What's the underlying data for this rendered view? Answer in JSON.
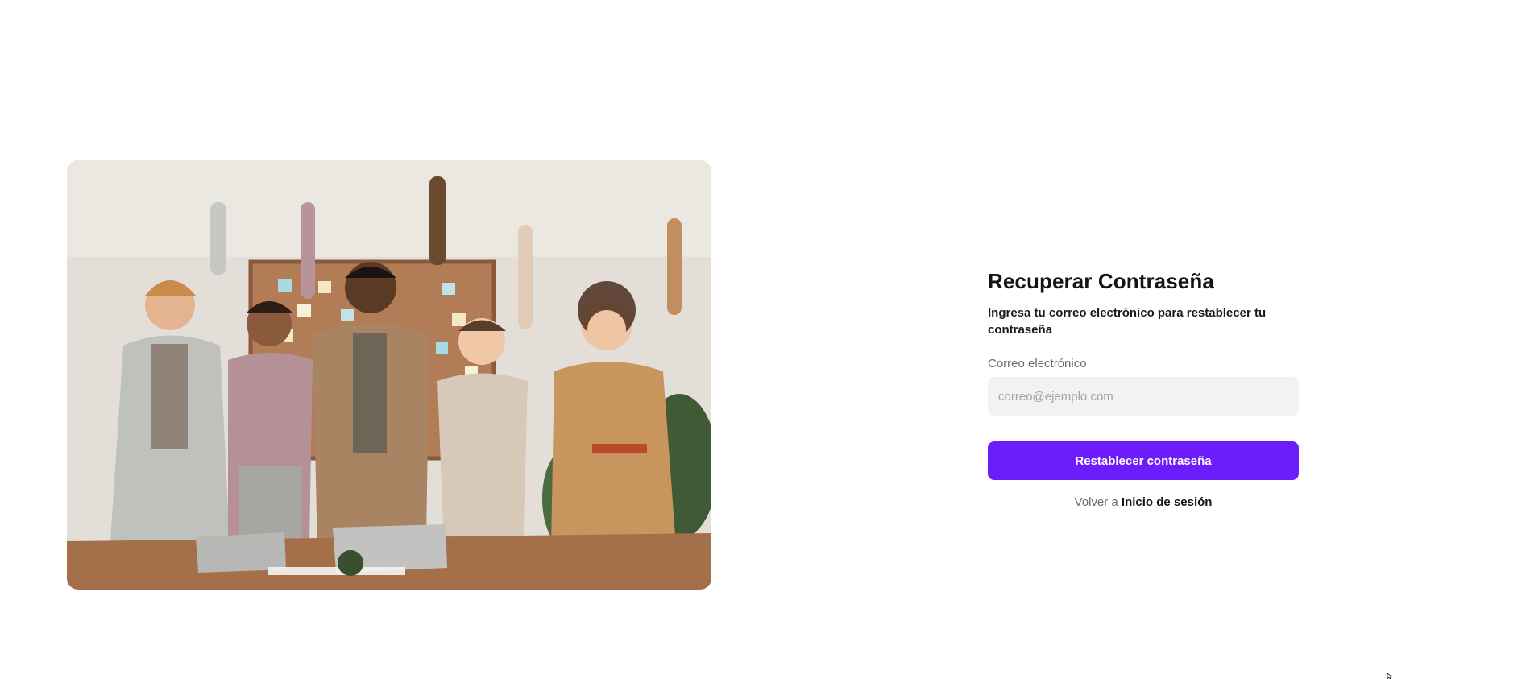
{
  "hero_image": {
    "icon": "team-celebration-photo",
    "colors": {
      "wall": "#e7e3dc",
      "corkboard": "#b27d56",
      "table": "#a4704a"
    }
  },
  "form": {
    "title": "Recuperar Contraseña",
    "subtitle": "Ingresa tu correo electrónico para restablecer tu contraseña",
    "email_label": "Correo electrónico",
    "email_value": "",
    "email_placeholder": "correo@ejemplo.com",
    "submit_label": "Restablecer contraseña",
    "back_prefix": "Volver a",
    "back_link": "Inicio de sesión"
  },
  "colors": {
    "accent": "#6d1cfb",
    "input_bg": "#f2f2f2",
    "text": "#141414",
    "muted": "#6b6b6b"
  }
}
